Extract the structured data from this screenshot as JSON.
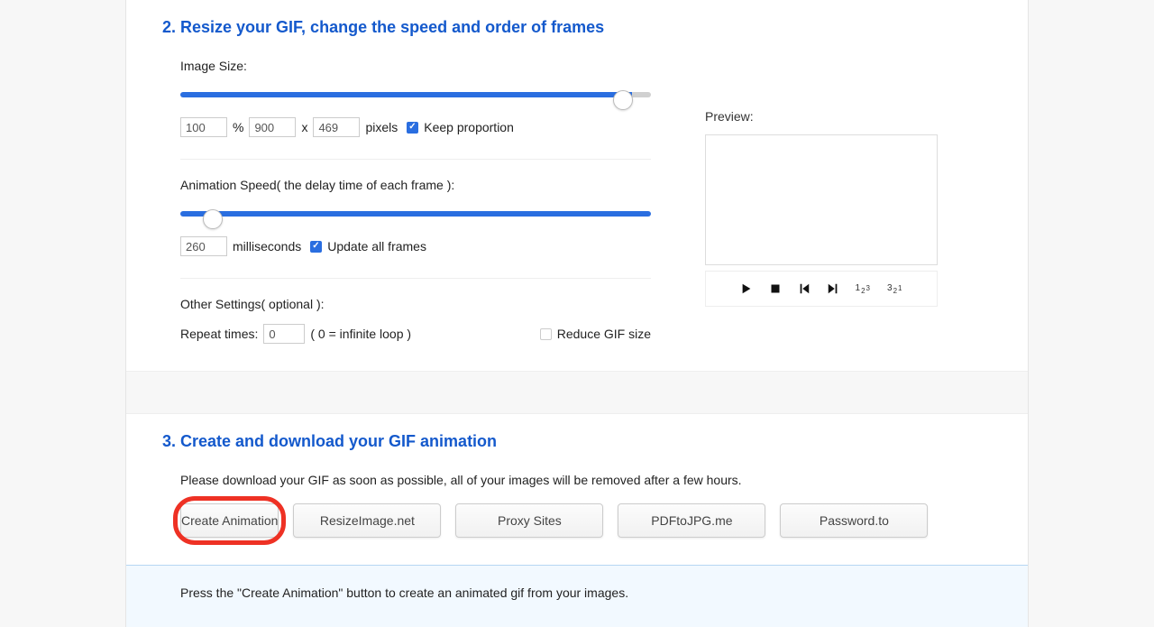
{
  "section2": {
    "heading": "2. Resize your GIF, change the speed and order of frames",
    "imageSize": {
      "label": "Image Size:",
      "percent": "100",
      "percentUnit": "%",
      "width": "900",
      "x": "x",
      "height": "469",
      "pixelsUnit": "pixels",
      "keepProportionLabel": "Keep proportion"
    },
    "speed": {
      "label": "Animation Speed( the delay time of each frame ):",
      "value": "260",
      "unit": "milliseconds",
      "updateAllLabel": "Update all frames"
    },
    "other": {
      "label": "Other Settings( optional ):",
      "repeatLabel": "Repeat times:",
      "repeatValue": "0",
      "repeatHint": "( 0 = infinite loop )",
      "reduceLabel": "Reduce GIF size"
    },
    "preview": {
      "label": "Preview:",
      "orderAsc": "1",
      "orderAscMid": "2",
      "orderAscLast": "3",
      "orderDesc": "3",
      "orderDescMid": "2",
      "orderDescLast": "1"
    }
  },
  "section3": {
    "heading": "3. Create and download your GIF animation",
    "desc": "Please download your GIF as soon as possible, all of your images will be removed after a few hours.",
    "buttons": {
      "create": "Create Animation",
      "resize": "ResizeImage.net",
      "proxy": "Proxy Sites",
      "pdf": "PDFtoJPG.me",
      "password": "Password.to"
    }
  },
  "info": {
    "text": "Press the \"Create Animation\" button to create an animated gif from your images."
  }
}
